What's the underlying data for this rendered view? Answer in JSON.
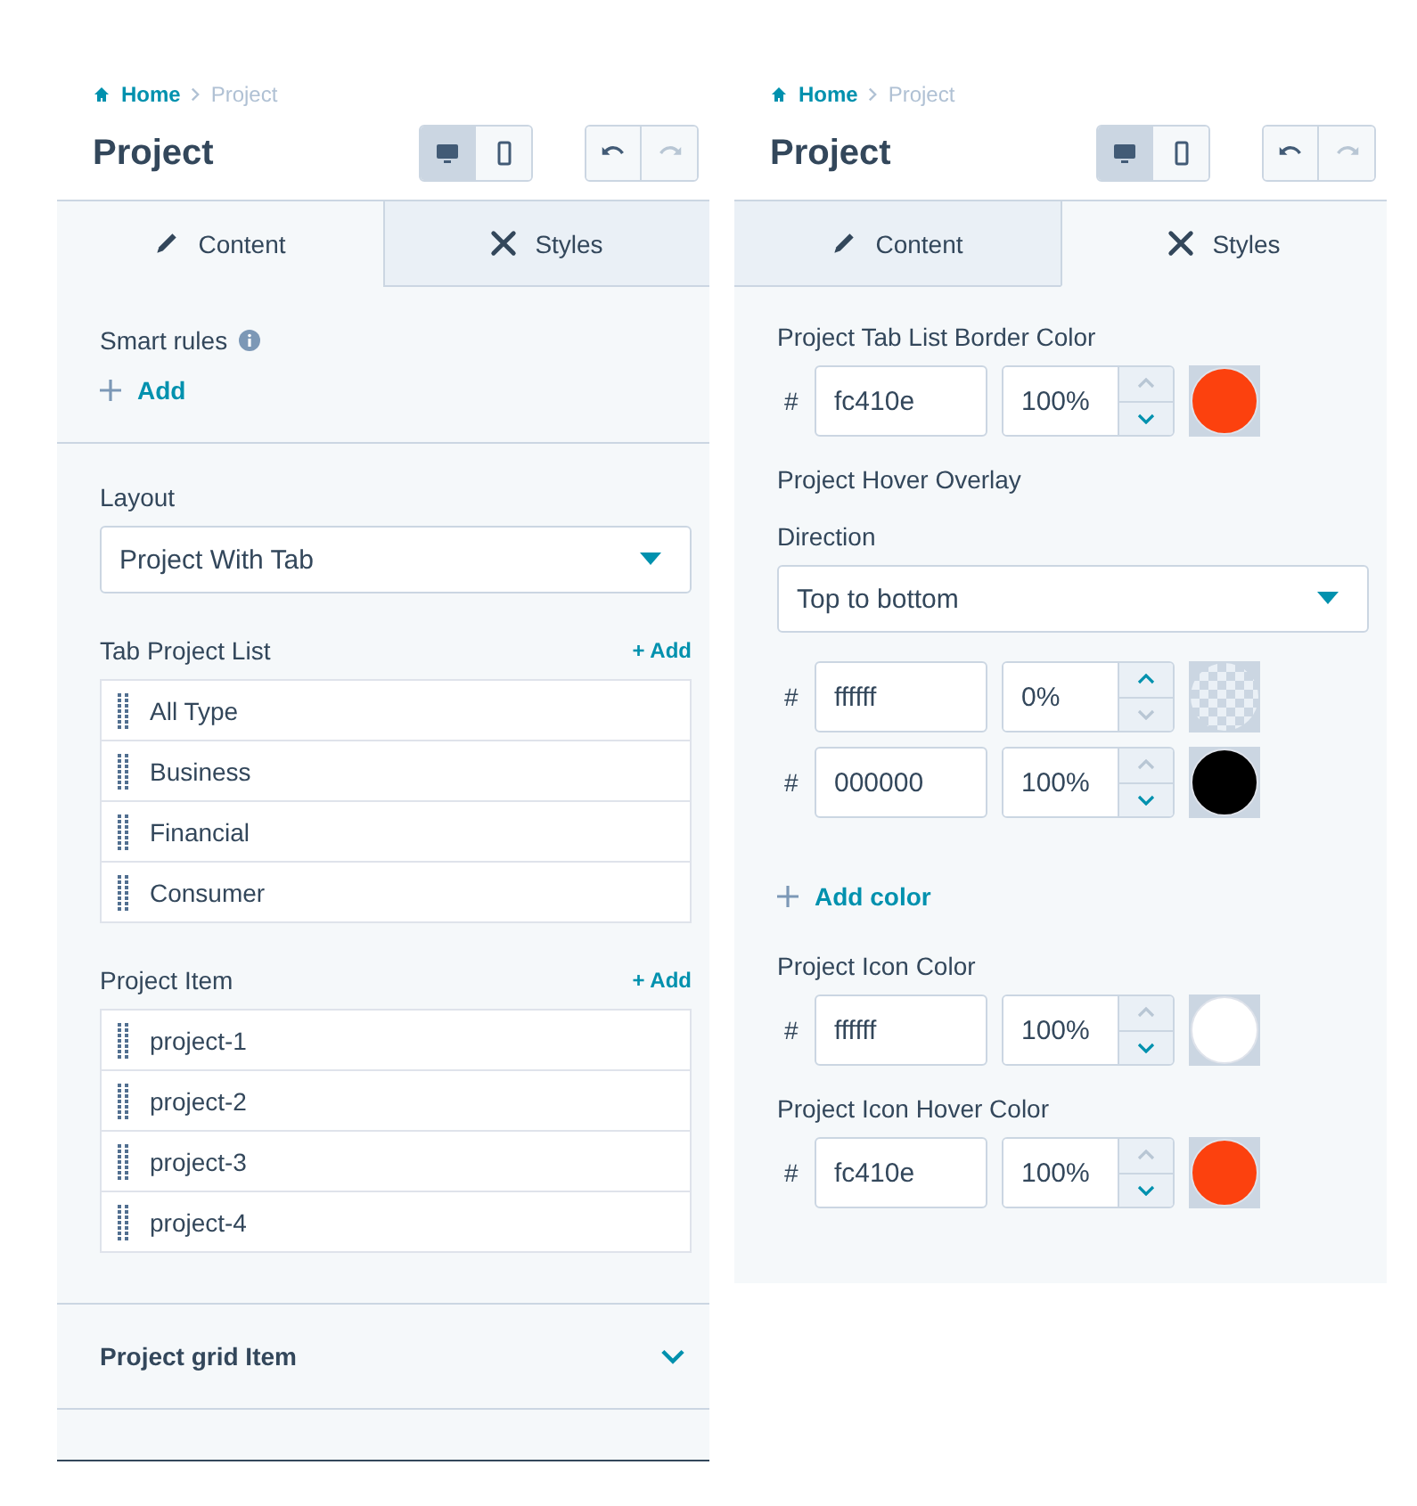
{
  "panels": [
    {
      "breadcrumb": [
        {
          "label": "Home"
        },
        {
          "label": "Project"
        }
      ],
      "title": "Project",
      "device_buttons": [
        {
          "kind": "desktop",
          "selected": true
        },
        {
          "kind": "mobile",
          "selected": false
        }
      ],
      "history_buttons": [
        {
          "kind": "undo",
          "disabled": false
        },
        {
          "kind": "redo",
          "disabled": true
        }
      ],
      "tabs": [
        {
          "label": "Content",
          "kind": "pencil",
          "selected": true
        },
        {
          "label": "Styles",
          "kind": "brush",
          "selected": false
        }
      ],
      "sections": [
        {
          "kind": "smart_rules",
          "label": "Smart rules",
          "add_label": "Add"
        },
        {
          "kind": "layout",
          "label": "Layout",
          "select_value": "Project With Tab",
          "lists": [
            {
              "label": "Tab Project List",
              "add_label": "+ Add",
              "items": [
                "All Type",
                "Business",
                "Financial",
                "Consumer"
              ]
            },
            {
              "label": "Project Item",
              "add_label": "+ Add",
              "items": [
                "project-1",
                "project-2",
                "project-3",
                "project-4"
              ]
            }
          ]
        },
        {
          "kind": "collapsible",
          "label": "Project grid Item",
          "expanded": false
        }
      ]
    },
    {
      "breadcrumb": [
        {
          "label": "Home"
        },
        {
          "label": "Project"
        }
      ],
      "title": "Project",
      "device_buttons": [
        {
          "kind": "desktop",
          "selected": true
        },
        {
          "kind": "mobile",
          "selected": false
        }
      ],
      "history_buttons": [
        {
          "kind": "undo",
          "disabled": false
        },
        {
          "kind": "redo",
          "disabled": true
        }
      ],
      "tabs": [
        {
          "label": "Content",
          "kind": "pencil",
          "selected": false
        },
        {
          "label": "Styles",
          "kind": "brush",
          "selected": true
        }
      ],
      "sections": [
        {
          "kind": "styles",
          "groups": [
            {
              "kind": "color",
              "label": "Project Tab List Border Color",
              "rows": [
                {
                  "prefix": "#",
                  "hex": "fc410e",
                  "opacity": "100%",
                  "color": "#fc410e",
                  "up_disabled": true,
                  "down_disabled": false
                }
              ]
            },
            {
              "kind": "heading",
              "label": "Project Hover Overlay"
            },
            {
              "kind": "select",
              "label": "Direction",
              "value": "Top to bottom"
            },
            {
              "kind": "color",
              "rows": [
                {
                  "prefix": "#",
                  "hex": "ffffff",
                  "opacity": "0%",
                  "up_disabled": false,
                  "down_disabled": true
                },
                {
                  "prefix": "#",
                  "hex": "000000",
                  "opacity": "100%",
                  "color": "#000000",
                  "up_disabled": true,
                  "down_disabled": false
                }
              ]
            },
            {
              "kind": "add",
              "label": "Add color"
            },
            {
              "kind": "color",
              "label": "Project Icon Color",
              "rows": [
                {
                  "prefix": "#",
                  "hex": "ffffff",
                  "opacity": "100%",
                  "color": "#ffffff",
                  "up_disabled": true,
                  "down_disabled": false
                }
              ]
            },
            {
              "kind": "color",
              "label": "Project Icon Hover Color",
              "rows": [
                {
                  "prefix": "#",
                  "hex": "fc410e",
                  "opacity": "100%",
                  "color": "#fc410e",
                  "up_disabled": true,
                  "down_disabled": false
                }
              ]
            }
          ]
        }
      ]
    }
  ]
}
